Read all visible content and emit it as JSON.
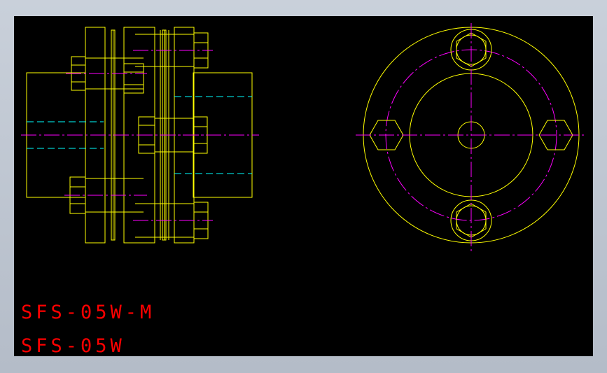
{
  "labels": {
    "model_m": "SFS-05W-M",
    "model": "SFS-05W"
  },
  "colors": {
    "background": "#000000",
    "frame": "#b4bcc8",
    "outline": "#ffff00",
    "centerline": "#ff00ff",
    "hidden_line": "#00ffff",
    "text": "#ff0000"
  }
}
